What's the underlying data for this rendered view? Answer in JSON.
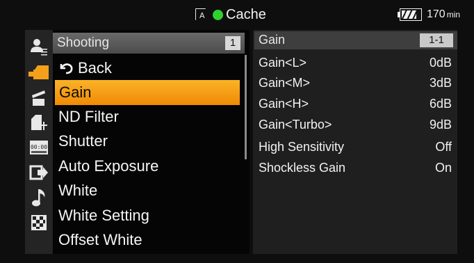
{
  "status": {
    "media_icon": "memory-card-a-icon",
    "media_letter": "A",
    "record_indicator_color": "#2fd12f",
    "cache_label": "Cache",
    "battery_icon": "battery-icon",
    "battery_level": 0.8,
    "remaining_value": "170",
    "remaining_unit": "min"
  },
  "sidebar": {
    "icons": [
      "user-menu-icon",
      "camera-shooting-icon",
      "clapperboard-icon",
      "card-settings-icon",
      "timecode-icon",
      "output-icon",
      "audio-note-icon",
      "checker-system-icon"
    ]
  },
  "menu": {
    "title": "Shooting",
    "page": "1",
    "back_label": "Back",
    "selected_index": 1,
    "items": [
      "Back",
      "Gain",
      "ND Filter",
      "Shutter",
      "Auto Exposure",
      "White",
      "White Setting",
      "Offset White"
    ]
  },
  "detail": {
    "title": "Gain",
    "page": "1-1",
    "rows": [
      {
        "label": "Gain<L>",
        "value": "0dB"
      },
      {
        "label": "Gain<M>",
        "value": "3dB"
      },
      {
        "label": "Gain<H>",
        "value": "6dB"
      },
      {
        "label": "Gain<Turbo>",
        "value": "9dB"
      },
      {
        "label": "High Sensitivity",
        "value": "Off"
      },
      {
        "label": "Shockless Gain",
        "value": "On"
      }
    ]
  },
  "colors": {
    "selection": "#f5a01a",
    "menu_header": "#5a5a5a",
    "record_green": "#2fd12f"
  }
}
